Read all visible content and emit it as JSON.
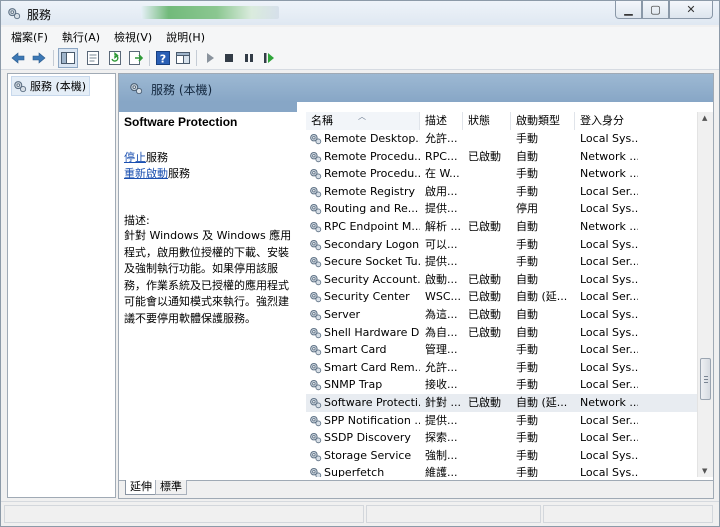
{
  "window": {
    "title": "服務"
  },
  "menu": [
    "檔案(F)",
    "執行(A)",
    "檢視(V)",
    "說明(H)"
  ],
  "toolbar_icons": [
    "back-arrow-icon",
    "forward-arrow-icon",
    "show-hide-tree-icon",
    "properties-icon",
    "refresh-icon",
    "export-list-icon",
    "help-icon",
    "console-view-icon",
    "start-service-icon",
    "stop-service-icon",
    "pause-service-icon",
    "restart-service-icon"
  ],
  "tree": {
    "root_label": "服務 (本機)"
  },
  "pane": {
    "header": "服務 (本機)"
  },
  "detail": {
    "service_name": "Software Protection",
    "stop_link": "停止",
    "stop_suffix": "服務",
    "restart_link": "重新啟動",
    "restart_suffix": "服務",
    "desc_label": "描述:",
    "desc_text": "針對 Windows 及 Windows 應用程式，啟用數位授權的下載、安裝及強制執行功能。如果停用該服務，作業系統及已授權的應用程式可能會以通知模式來執行。強烈建議不要停用軟體保護服務。"
  },
  "columns": [
    "名稱",
    "描述",
    "狀態",
    "啟動類型",
    "登入身分"
  ],
  "rows": [
    {
      "name": "Remote Desktop...",
      "desc": "允許...",
      "status": "",
      "start": "手動",
      "logon": "Local Sys..."
    },
    {
      "name": "Remote Procedu...",
      "desc": "RPC...",
      "status": "已啟動",
      "start": "自動",
      "logon": "Network ..."
    },
    {
      "name": "Remote Procedu...",
      "desc": "在 W...",
      "status": "",
      "start": "手動",
      "logon": "Network ..."
    },
    {
      "name": "Remote Registry",
      "desc": "啟用...",
      "status": "",
      "start": "手動",
      "logon": "Local Ser..."
    },
    {
      "name": "Routing and Re...",
      "desc": "提供...",
      "status": "",
      "start": "停用",
      "logon": "Local Sys..."
    },
    {
      "name": "RPC Endpoint M...",
      "desc": "解析 ...",
      "status": "已啟動",
      "start": "自動",
      "logon": "Network ..."
    },
    {
      "name": "Secondary Logon",
      "desc": "可以...",
      "status": "",
      "start": "手動",
      "logon": "Local Sys..."
    },
    {
      "name": "Secure Socket Tu...",
      "desc": "提供...",
      "status": "",
      "start": "手動",
      "logon": "Local Ser..."
    },
    {
      "name": "Security Account...",
      "desc": "啟動...",
      "status": "已啟動",
      "start": "自動",
      "logon": "Local Sys..."
    },
    {
      "name": "Security Center",
      "desc": "WSC...",
      "status": "已啟動",
      "start": "自動 (延...",
      "logon": "Local Ser..."
    },
    {
      "name": "Server",
      "desc": "為這...",
      "status": "已啟動",
      "start": "自動",
      "logon": "Local Sys..."
    },
    {
      "name": "Shell Hardware D...",
      "desc": "為自...",
      "status": "已啟動",
      "start": "自動",
      "logon": "Local Sys..."
    },
    {
      "name": "Smart Card",
      "desc": "管理...",
      "status": "",
      "start": "手動",
      "logon": "Local Ser..."
    },
    {
      "name": "Smart Card Rem...",
      "desc": "允許...",
      "status": "",
      "start": "手動",
      "logon": "Local Sys..."
    },
    {
      "name": "SNMP Trap",
      "desc": "接收...",
      "status": "",
      "start": "手動",
      "logon": "Local Ser..."
    },
    {
      "name": "Software Protecti...",
      "desc": "針對 ...",
      "status": "已啟動",
      "start": "自動 (延...",
      "logon": "Network ...",
      "selected": true
    },
    {
      "name": "SPP Notification ...",
      "desc": "提供...",
      "status": "",
      "start": "手動",
      "logon": "Local Ser..."
    },
    {
      "name": "SSDP Discovery",
      "desc": "探索...",
      "status": "",
      "start": "手動",
      "logon": "Local Ser..."
    },
    {
      "name": "Storage Service",
      "desc": "強制...",
      "status": "",
      "start": "手動",
      "logon": "Local Sys..."
    },
    {
      "name": "Superfetch",
      "desc": "維護...",
      "status": "",
      "start": "手動",
      "logon": "Local Sys..."
    }
  ],
  "tabs": [
    "延伸",
    "標準"
  ],
  "colors": {
    "header_blue": "#87a6c6",
    "link": "#1a4fb0",
    "selected_row": "#e8ecf1"
  }
}
